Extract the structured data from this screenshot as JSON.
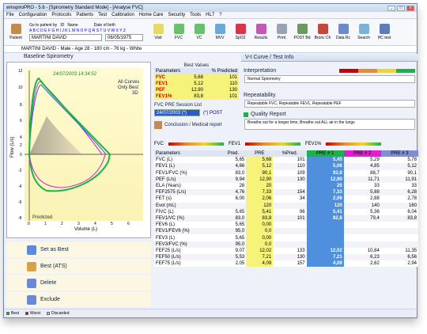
{
  "window": {
    "title": "winspiroPRO - 5.6 - [Spirometry Standard Mode] - [Analyse FVC]"
  },
  "menu": [
    "File",
    "Configuration",
    "Protocols",
    "Patients",
    "Test",
    "Calibration",
    "Home Care",
    "Security",
    "Tools",
    "HL7",
    "?"
  ],
  "toolbar": {
    "patient_label": "Patient",
    "goto_label": "Go to patient by",
    "id_label": "ID",
    "name_label": "Name",
    "dob_label": "Date of birth",
    "alphabet": "A B C D E F G H I J K L M N O P Q R S T U V W X Y Z",
    "name_value": "MARTINI DAVID",
    "dob_value": "06/05/1975",
    "buttons": [
      "Visit",
      "FVC",
      "VC",
      "MVV",
      "SpO2",
      "Results",
      "Print",
      "POST Bd",
      "Bronc Ch",
      "Data Rc",
      "Search",
      "HC test"
    ]
  },
  "info": "MARTINI DAVID - Male - Age 28 - 180 cm - 76 kg - White",
  "graph": {
    "title": "Baseline Spirometry",
    "date": "24/07/2003 14:34:52",
    "all_curves": "All Curves",
    "only_best": "Only Best",
    "view": "3D",
    "ylabel": "Flow (L/s)",
    "xlabel": "Volume (L)",
    "predicted": "Predicted",
    "yticks": [
      "12",
      "10",
      "8",
      "6",
      "4",
      "2",
      "0",
      "-2",
      "-4",
      "-6",
      "-8"
    ],
    "xticks": [
      "0",
      "1",
      "2",
      "3",
      "4",
      "5",
      "6"
    ]
  },
  "actions": [
    "Set as Best",
    "Best (ATS)",
    "Delete",
    "Exclude"
  ],
  "best_values": {
    "title": "Best Values",
    "headers": [
      "Parameters",
      "% Predicted"
    ],
    "rows": [
      [
        "FVC",
        "5,68",
        "101"
      ],
      [
        "FEV1",
        "5,12",
        "110"
      ],
      [
        "PEF",
        "12,90",
        "130"
      ],
      [
        "FEV1%",
        "83,8",
        "101"
      ]
    ]
  },
  "session": {
    "title": "FVC PRE Session List",
    "date": "24/07/2003 (*)",
    "post": "(*) POST",
    "conclusion": "Conclusion / Medical report"
  },
  "right": {
    "vt_title": "V-t Curve / Test Info",
    "interp_title": "Interpretation",
    "interp_text": "Normal Spirometry",
    "repeat_title": "Repeatability",
    "repeat_text": "Repeatable FVC, Repeatable FEV1, Repeatable PEF",
    "quality_title": "Quality Report",
    "quality_text": "Breathe out for a longer time, Breathe out ALL air in the lungs"
  },
  "bars": [
    "FVC",
    "FEV1",
    "FEV1%"
  ],
  "table": {
    "headers": [
      "Parameters",
      "Pred.",
      "PRE",
      "%Pred.",
      "PRE # 1",
      "PRE # 2",
      "PRE # 3"
    ],
    "rows": [
      [
        "FVC (L)",
        "5,65",
        "5,68",
        "101",
        "5,45",
        "5,29",
        "5,78"
      ],
      [
        "FEV1 (L)",
        "4,66",
        "5,12",
        "110",
        "5,06",
        "4,85",
        "5,12"
      ],
      [
        "FEV1/FVC (%)",
        "83,0",
        "90,1",
        "109",
        "92,8",
        "88,7",
        "90,1"
      ],
      [
        "PEF (L/s)",
        "9,94",
        "12,90",
        "130",
        "12,90",
        "11,71",
        "11,91"
      ],
      [
        "ELA (Years)",
        "28",
        "20",
        "",
        "20",
        "33",
        "33"
      ],
      [
        "FEF2575 (L/s)",
        "4,76",
        "7,33",
        "154",
        "7,33",
        "5,88",
        "6,28"
      ],
      [
        "FET (s)",
        "6,00",
        "2,06",
        "34",
        "2,06",
        "2,88",
        "2,78"
      ],
      [
        "Evol (mL)",
        "",
        "120",
        "",
        "120",
        "140",
        "160"
      ],
      [
        "FIVC (L)",
        "5,65",
        "5,41",
        "96",
        "5,41",
        "5,36",
        "6,04"
      ],
      [
        "FEV1/VC (%)",
        "83,0",
        "83,8",
        "101",
        "82,8",
        "79,4",
        "83,8"
      ],
      [
        "FEV6 (L)",
        "5,65",
        "0,00",
        "",
        "",
        "",
        ""
      ],
      [
        "FEV1/FEV6 (%)",
        "95,0",
        "0,0",
        "",
        "",
        "",
        ""
      ],
      [
        "FEV3 (L)",
        "5,65",
        "0,00",
        "",
        "",
        "",
        ""
      ],
      [
        "FEV3/FVC (%)",
        "95,0",
        "0,0",
        "",
        "",
        "",
        ""
      ],
      [
        "FEF25 (L/s)",
        "9,07",
        "12,02",
        "133",
        "12,02",
        "10,84",
        "11,35"
      ],
      [
        "FEF50 (L/s)",
        "5,53",
        "7,21",
        "130",
        "7,21",
        "6,23",
        "6,56"
      ],
      [
        "FEF75 (L/s)",
        "2,05",
        "4,09",
        "157",
        "4,09",
        "2,62",
        "2,94"
      ]
    ]
  },
  "legend": [
    "Best",
    "Worst",
    "Discarded"
  ],
  "colors": {
    "pre1": "#4f8fdc",
    "pre2": "#e41ad6",
    "pre3": "#7d8fd2",
    "yellow": "#f7f27a",
    "green": "#1ab34a"
  }
}
